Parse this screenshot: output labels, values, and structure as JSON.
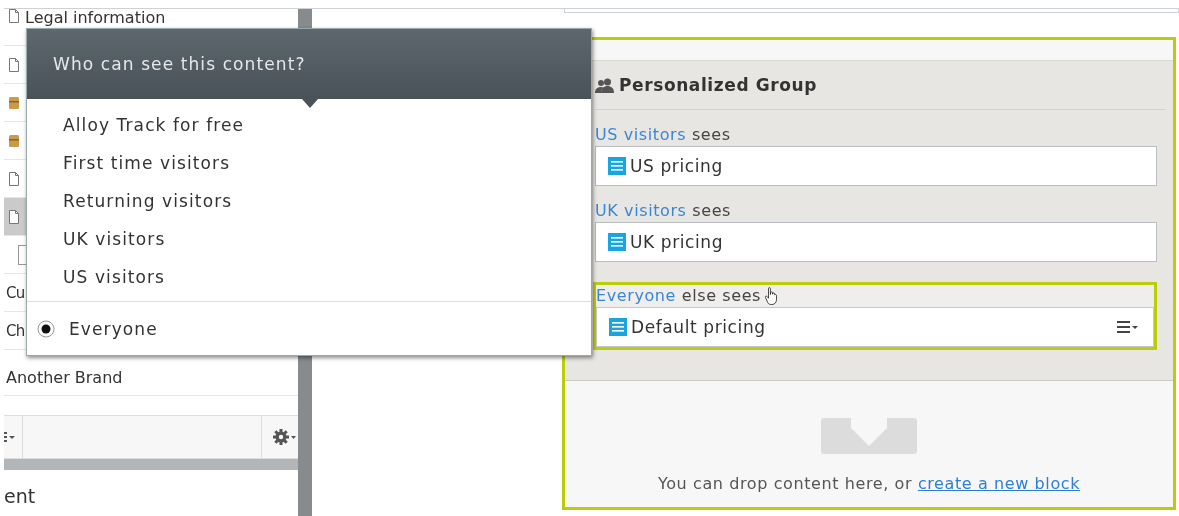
{
  "tree": {
    "items": [
      {
        "kind": "page",
        "label": "Legal information",
        "selected": false
      },
      {
        "kind": "page",
        "selected": false
      },
      {
        "kind": "box",
        "selected": false
      },
      {
        "kind": "box",
        "selected": false
      },
      {
        "kind": "page",
        "selected": false
      },
      {
        "kind": "page",
        "selected": true
      },
      {
        "kind": "square",
        "selected": false
      },
      {
        "kind": "plain",
        "label": "Cu",
        "selected": false
      },
      {
        "kind": "plain",
        "label": "Ch",
        "selected": false
      },
      {
        "kind": "plain",
        "label": "Another Brand",
        "selected": false
      }
    ]
  },
  "lower_panel": {
    "text": "ent"
  },
  "popup": {
    "title": "Who can see this content?",
    "options": [
      {
        "label": "Alloy Track for free",
        "selected": false
      },
      {
        "label": "First time visitors",
        "selected": false
      },
      {
        "label": "Returning visitors",
        "selected": false
      },
      {
        "label": "UK visitors",
        "selected": false
      },
      {
        "label": "US visitors",
        "selected": false
      }
    ],
    "fallback": {
      "label": "Everyone",
      "selected": true
    }
  },
  "group": {
    "title": "Personalized Group",
    "entries": [
      {
        "audience": "US visitors",
        "suffix": "sees",
        "block": "US pricing",
        "active": false
      },
      {
        "audience": "UK visitors",
        "suffix": "sees",
        "block": "UK pricing",
        "active": false
      },
      {
        "audience": "Everyone",
        "suffix": "else sees",
        "block": "Default pricing",
        "active": true
      }
    ]
  },
  "drop_zone": {
    "text": "You can drop content here, or",
    "link": "create a new block"
  }
}
